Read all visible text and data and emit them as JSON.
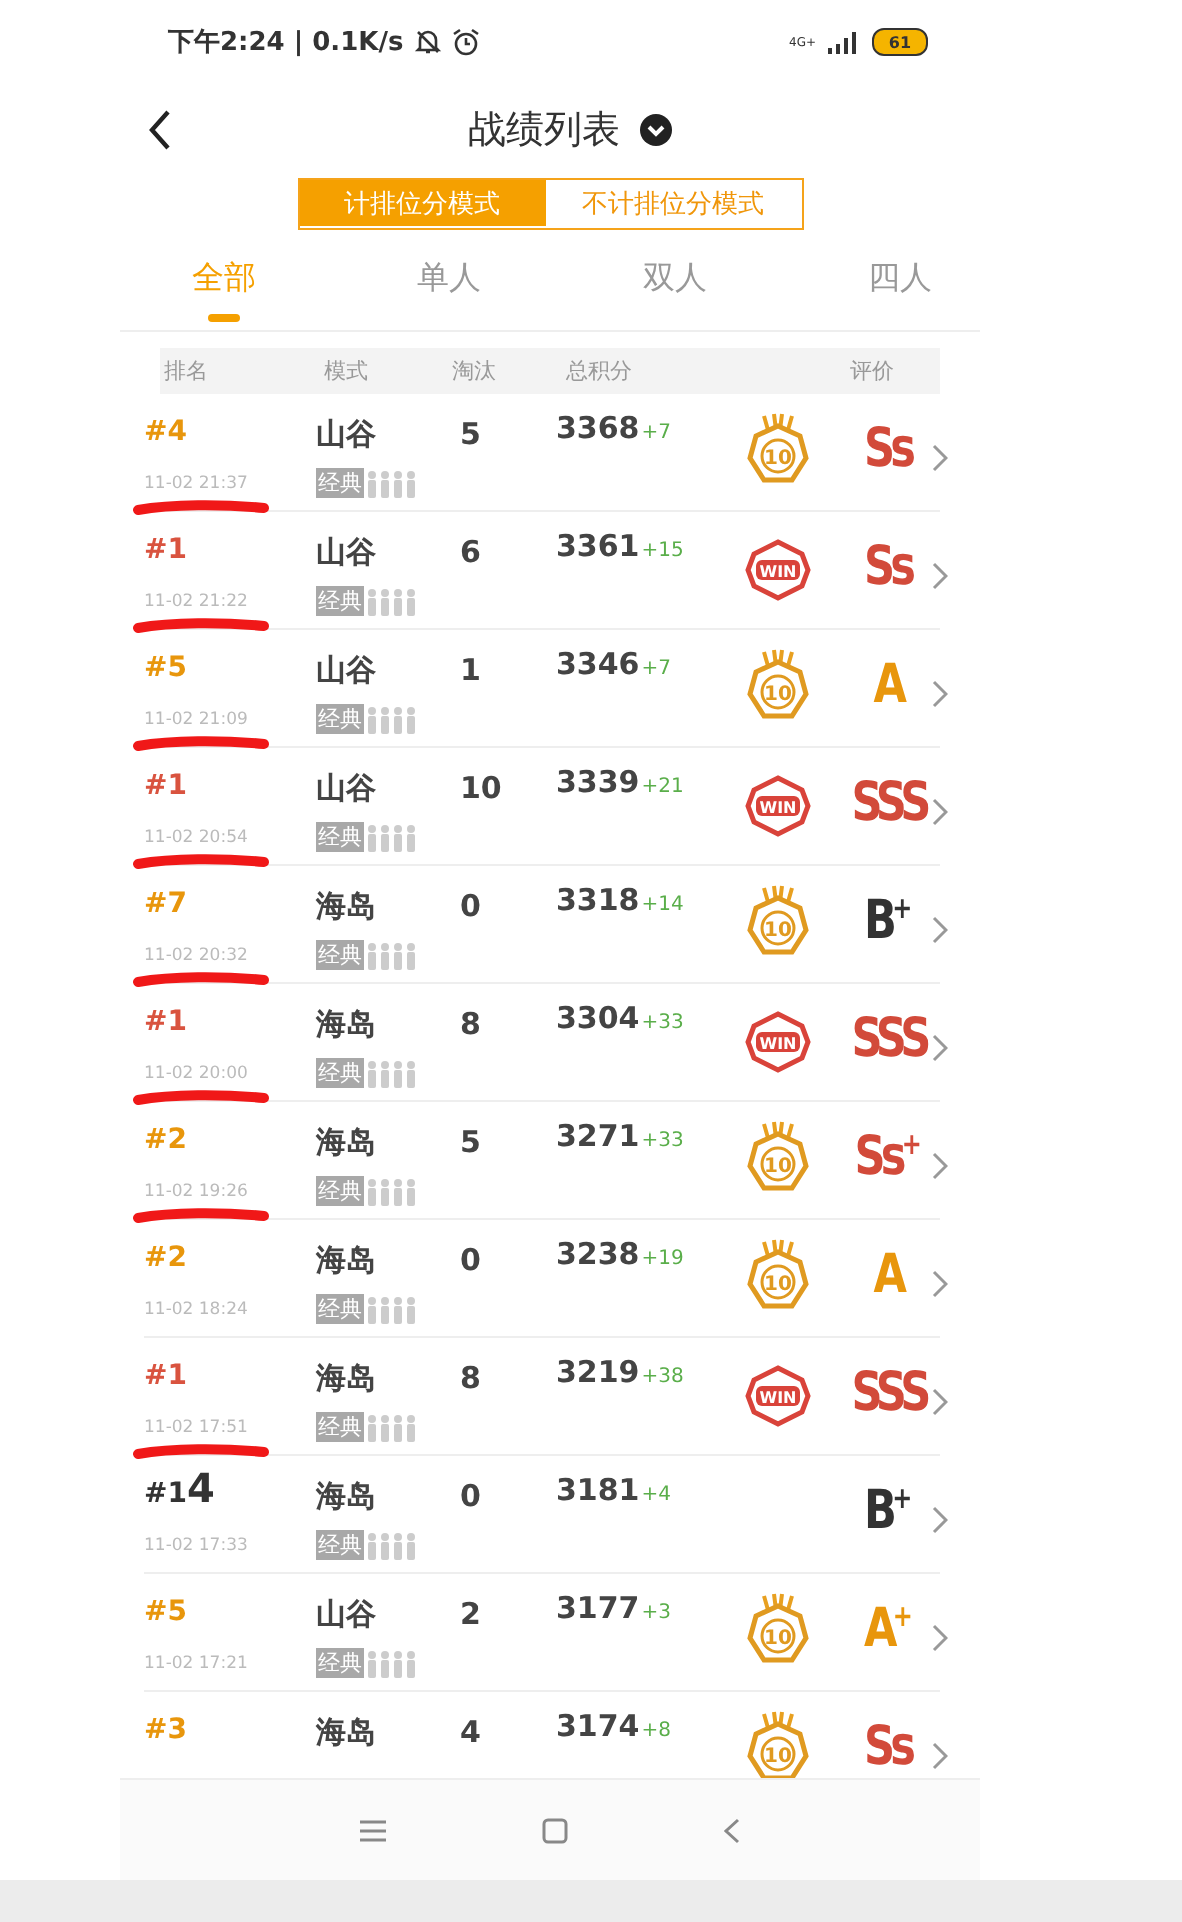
{
  "status_bar": {
    "time_speed": "下午2:24 | 0.1K/s",
    "network": "4G+",
    "battery": "61"
  },
  "header": {
    "title": "战绩列表"
  },
  "mode_toggle": [
    {
      "label": "计排位分模式",
      "selected": true
    },
    {
      "label": "不计排位分模式",
      "selected": false
    }
  ],
  "tabs": [
    {
      "label": "全部",
      "selected": true
    },
    {
      "label": "单人",
      "selected": false
    },
    {
      "label": "双人",
      "selected": false
    },
    {
      "label": "四人",
      "selected": false
    }
  ],
  "table": {
    "columns": [
      "排名",
      "模式",
      "淘汰",
      "总积分",
      "评价"
    ],
    "rows": [
      {
        "rank": {
          "text": "#4",
          "color": "#e8960c"
        },
        "date": "11-02 21:37",
        "mode": "山谷",
        "tag": "经典",
        "eliminations": "5",
        "score": "3368",
        "delta": "+7",
        "badge": {
          "kind": "top10",
          "label": "10"
        },
        "grade": {
          "text": "Ss",
          "color": "#d24a3a"
        },
        "underlined": true
      },
      {
        "rank": {
          "text": "#1",
          "color": "#d9533f"
        },
        "date": "11-02 21:22",
        "mode": "山谷",
        "tag": "经典",
        "eliminations": "6",
        "score": "3361",
        "delta": "+15",
        "badge": {
          "kind": "win",
          "label": "WIN"
        },
        "grade": {
          "text": "Ss",
          "color": "#d24a3a"
        },
        "underlined": true
      },
      {
        "rank": {
          "text": "#5",
          "color": "#e8960c"
        },
        "date": "11-02 21:09",
        "mode": "山谷",
        "tag": "经典",
        "eliminations": "1",
        "score": "3346",
        "delta": "+7",
        "badge": {
          "kind": "top10",
          "label": "10"
        },
        "grade": {
          "text": "A",
          "color": "#e8960c"
        },
        "underlined": true
      },
      {
        "rank": {
          "text": "#1",
          "color": "#d9533f"
        },
        "date": "11-02 20:54",
        "mode": "山谷",
        "tag": "经典",
        "eliminations": "10",
        "score": "3339",
        "delta": "+21",
        "badge": {
          "kind": "win",
          "label": "WIN"
        },
        "grade": {
          "text": "SSS",
          "color": "#d24a3a"
        },
        "underlined": true
      },
      {
        "rank": {
          "text": "#7",
          "color": "#e8960c"
        },
        "date": "11-02 20:32",
        "mode": "海岛",
        "tag": "经典",
        "eliminations": "0",
        "score": "3318",
        "delta": "+14",
        "badge": {
          "kind": "top10",
          "label": "10"
        },
        "grade": {
          "text": "B$^{+}$",
          "color": "#333333"
        },
        "underlined": true
      },
      {
        "rank": {
          "text": "#1",
          "color": "#d9533f"
        },
        "date": "11-02 20:00",
        "mode": "海岛",
        "tag": "经典",
        "eliminations": "8",
        "score": "3304",
        "delta": "+33",
        "badge": {
          "kind": "win",
          "label": "WIN"
        },
        "grade": {
          "text": "SSS",
          "color": "#d24a3a"
        },
        "underlined": true
      },
      {
        "rank": {
          "text": "#2",
          "color": "#e8960c"
        },
        "date": "11-02 19:26",
        "mode": "海岛",
        "tag": "经典",
        "eliminations": "5",
        "score": "3271",
        "delta": "+33",
        "badge": {
          "kind": "top10",
          "label": "10"
        },
        "grade": {
          "text": "Ss$^{+}$",
          "color": "#d24a3a"
        },
        "underlined": true
      },
      {
        "rank": {
          "text": "#2",
          "color": "#e8960c"
        },
        "date": "11-02 18:24",
        "mode": "海岛",
        "tag": "经典",
        "eliminations": "0",
        "score": "3238",
        "delta": "+19",
        "badge": {
          "kind": "top10",
          "label": "10"
        },
        "grade": {
          "text": "A",
          "color": "#e8960c"
        },
        "underlined": false
      },
      {
        "rank": {
          "text": "#1",
          "color": "#d9533f"
        },
        "date": "11-02 17:51",
        "mode": "海岛",
        "tag": "经典",
        "eliminations": "8",
        "score": "3219",
        "delta": "+38",
        "badge": {
          "kind": "win",
          "label": "WIN"
        },
        "grade": {
          "text": "SSS",
          "color": "#d24a3a"
        },
        "underlined": true
      },
      {
        "rank": {
          "text": "#14",
          "color": "#333333"
        },
        "date": "11-02 17:33",
        "mode": "海岛",
        "tag": "经典",
        "eliminations": "0",
        "score": "3181",
        "delta": "+4",
        "grade": {
          "text": "B$^{+}$",
          "color": "#333333"
        },
        "underlined": false
      },
      {
        "rank": {
          "text": "#5",
          "color": "#e8960c"
        },
        "date": "11-02 17:21",
        "mode": "山谷",
        "tag": "经典",
        "eliminations": "2",
        "score": "3177",
        "delta": "+3",
        "badge": {
          "kind": "top10",
          "label": "10"
        },
        "grade": {
          "text": "A$^{+}$",
          "color": "#e8960c"
        },
        "underlined": false
      },
      {
        "rank": {
          "text": "#3",
          "color": "#e8960c"
        },
        "mode": "海岛",
        "eliminations": "4",
        "score": "3174",
        "delta": "+8",
        "badge": {
          "kind": "top10",
          "label": "10"
        },
        "grade": {
          "text": "Ss",
          "color": "#d24a3a"
        },
        "underlined": false
      }
    ]
  }
}
